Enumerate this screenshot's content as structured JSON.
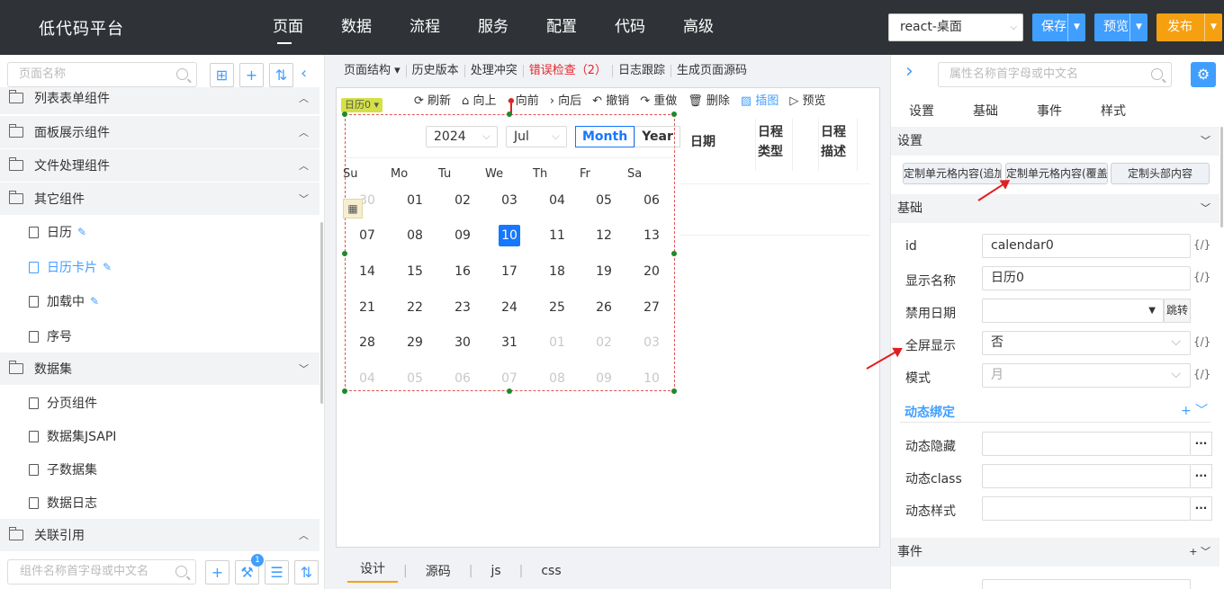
{
  "topbar": {
    "brand": "低代码平台",
    "nav": [
      "页面",
      "数据",
      "流程",
      "服务",
      "配置",
      "代码",
      "高级"
    ],
    "env": "react-桌面",
    "save": "保存",
    "preview": "预览",
    "publish": "发布"
  },
  "left": {
    "search_placeholder": "页面名称",
    "search2_placeholder": "组件名称首字母或中文名",
    "badge": "1",
    "groups": [
      "列表表单组件",
      "面板展示组件",
      "文件处理组件",
      "其它组件",
      "数据集",
      "关联引用"
    ],
    "items_other": [
      "日历",
      "日历卡片",
      "加载中",
      "序号"
    ],
    "items_data": [
      "分页组件",
      "数据集JSAPI",
      "子数据集",
      "数据日志"
    ]
  },
  "mid": {
    "toolbar": [
      "页面结构 ▾",
      "历史版本",
      "处理冲突",
      "错误检查（2）",
      "日志跟踪",
      "生成页面源码"
    ],
    "ctools": [
      "刷新",
      "向上",
      "向前",
      "向后",
      "撤销",
      "重做",
      "删除",
      "插图",
      "预览"
    ],
    "tag": "日历0",
    "cal": {
      "year": "2024",
      "month": "Jul",
      "mode_month": "Month",
      "mode_year": "Year",
      "weekdays": [
        "Su",
        "Mo",
        "Tu",
        "We",
        "Th",
        "Fr",
        "Sa"
      ],
      "rows": [
        [
          "30",
          "01",
          "02",
          "03",
          "04",
          "05",
          "06"
        ],
        [
          "07",
          "08",
          "09",
          "10",
          "11",
          "12",
          "13"
        ],
        [
          "14",
          "15",
          "16",
          "17",
          "18",
          "19",
          "20"
        ],
        [
          "21",
          "22",
          "23",
          "24",
          "25",
          "26",
          "27"
        ],
        [
          "28",
          "29",
          "30",
          "31",
          "01",
          "02",
          "03"
        ],
        [
          "04",
          "05",
          "06",
          "07",
          "08",
          "09",
          "10"
        ]
      ]
    },
    "table_headers": [
      "日期",
      "日程\n类型",
      "日程\n描述"
    ],
    "bottom_tabs": [
      "设计",
      "源码",
      "js",
      "css"
    ]
  },
  "right": {
    "search_placeholder": "属性名称首字母或中文名",
    "tabs": [
      "设置",
      "基础",
      "事件",
      "样式"
    ],
    "sect_settings": "设置",
    "btn1": "定制单元格内容(追加)",
    "btn2": "定制单元格内容(覆盖)",
    "btn3": "定制头部内容",
    "sect_basic": "基础",
    "fields": {
      "id_label": "id",
      "id_val": "calendar0",
      "name_label": "显示名称",
      "name_val": "日历0",
      "disable_label": "禁用日期",
      "jump": "跳转",
      "full_label": "全屏显示",
      "full_val": "否",
      "mode_label": "模式",
      "mode_val": "月"
    },
    "dyn": "动态绑定",
    "dyn_hidden": "动态隐藏",
    "dyn_class": "动态class",
    "dyn_style": "动态样式",
    "sect_event": "事件",
    "fx": "{/}"
  }
}
